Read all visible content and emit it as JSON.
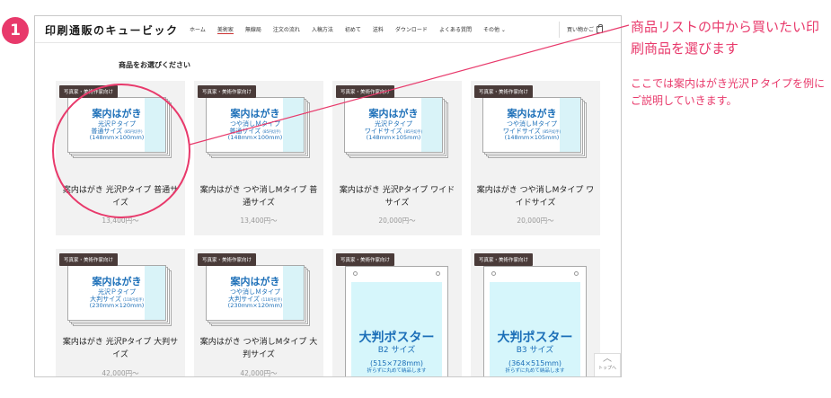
{
  "step": {
    "number": "1"
  },
  "site": {
    "logo": "印刷通販のキュービック",
    "nav": [
      "ホーム",
      "美術家",
      "無線局",
      "注文の流れ",
      "入稿方法",
      "初めて",
      "送料",
      "ダウンロード",
      "よくある質問",
      "その他 ⌄"
    ],
    "active_nav_index": 1,
    "cart_label": "買い物かご"
  },
  "section": {
    "title": "商品をお選びください"
  },
  "products": [
    {
      "tag": "写真家・美術作家向け",
      "thumb_title": "案内はがき",
      "thumb_sub": "光沢Ｐタイプ",
      "thumb_size": "普通サイズ",
      "thumb_size_note": "(85円切手)",
      "thumb_dim": "(148mm×100mm)",
      "name": "案内はがき 光沢Pタイプ 普通サイズ",
      "price": "13,400円〜"
    },
    {
      "tag": "写真家・美術作家向け",
      "thumb_title": "案内はがき",
      "thumb_sub": "つや消しＭタイプ",
      "thumb_size": "普通サイズ",
      "thumb_size_note": "(85円切手)",
      "thumb_dim": "(148mm×100mm)",
      "name": "案内はがき つや消しMタイプ 普通サイズ",
      "price": "13,400円〜"
    },
    {
      "tag": "写真家・美術作家向け",
      "thumb_title": "案内はがき",
      "thumb_sub": "光沢Ｐタイプ",
      "thumb_size": "ワイドサイズ",
      "thumb_size_note": "(85円切手)",
      "thumb_dim": "(148mm×105mm)",
      "name": "案内はがき 光沢Pタイプ ワイドサイズ",
      "price": "20,000円〜"
    },
    {
      "tag": "写真家・美術作家向け",
      "thumb_title": "案内はがき",
      "thumb_sub": "つや消しＭタイプ",
      "thumb_size": "ワイドサイズ",
      "thumb_size_note": "(85円切手)",
      "thumb_dim": "(148mm×105mm)",
      "name": "案内はがき つや消しMタイプ ワイドサイズ",
      "price": "20,000円〜"
    },
    {
      "tag": "写真家・美術作家向け",
      "thumb_title": "案内はがき",
      "thumb_sub": "光沢Ｐタイプ",
      "thumb_size": "大判サイズ",
      "thumb_size_note": "(110円切手)",
      "thumb_dim": "(230mm×120mm)",
      "name": "案内はがき 光沢Pタイプ 大判サイズ",
      "price": "42,000円〜"
    },
    {
      "tag": "写真家・美術作家向け",
      "thumb_title": "案内はがき",
      "thumb_sub": "つや消しＭタイプ",
      "thumb_size": "大判サイズ",
      "thumb_size_note": "(110円切手)",
      "thumb_dim": "(230mm×120mm)",
      "name": "案内はがき つや消しMタイプ 大判サイズ",
      "price": "42,000円〜"
    },
    {
      "tag": "写真家・美術作家向け",
      "poster_title": "大判ポスター",
      "poster_sub": "B2 サイズ",
      "poster_dim": "(515×728mm)",
      "poster_note": "折らずに丸めて納品します"
    },
    {
      "tag": "写真家・美術作家向け",
      "poster_title": "大判ポスター",
      "poster_sub": "B3 サイズ",
      "poster_dim": "(364×515mm)",
      "poster_note": "折らずに丸めて納品します"
    }
  ],
  "to_top": {
    "label": "トップへ",
    "icon": "chevron-up-icon"
  },
  "annotation": {
    "main": "商品リストの中から買いたい印刷商品を選びます",
    "sub": "ここでは案内はがき光沢Ｐタイプを例にご説明していきます。",
    "color": "#e8396b"
  }
}
